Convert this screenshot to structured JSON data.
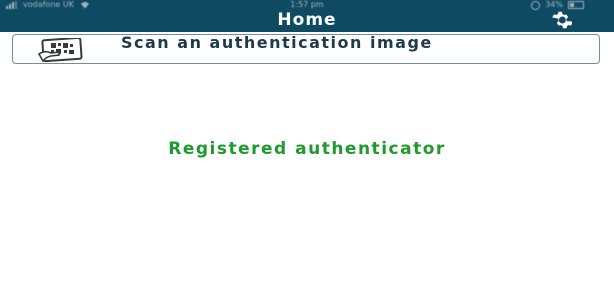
{
  "status_bar": {
    "carrier": "vodafone UK",
    "time": "1:57 pm",
    "battery": "34%"
  },
  "header": {
    "title": "Home",
    "settings_icon": "gear-icon",
    "background_color": "#0f4a63"
  },
  "scan_button": {
    "label": "Scan an authentication image",
    "icon": "qr-scan-icon"
  },
  "status_message": {
    "text": "Registered authenticator",
    "color": "#1f9a2e"
  }
}
